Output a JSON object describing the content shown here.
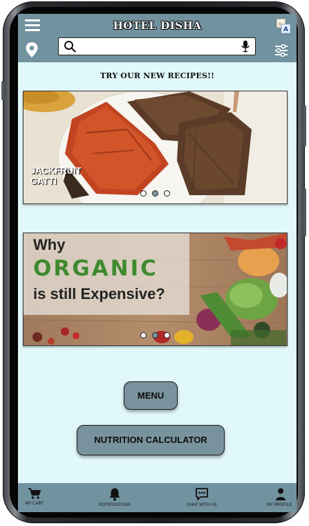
{
  "header": {
    "title": "HOTEL DISHA",
    "search": {
      "value": "",
      "placeholder": ""
    }
  },
  "recipes": {
    "heading": "TRY OUR NEW RECIPES!!",
    "slide_text": "JACKFRUIT\nGATTI",
    "slide_count": 3,
    "active_slide": 2
  },
  "organic": {
    "line1": "Why",
    "line2": "ORGANIC",
    "line3": "is still Expensive?",
    "slide_count": 3,
    "active_slide": 2
  },
  "buttons": {
    "menu": "MENU",
    "nutrition": "NUTRITION CALCULATOR"
  },
  "bottom_nav": [
    {
      "label": "MY CART",
      "icon": "cart-icon"
    },
    {
      "label": "NOTIFICATIONS",
      "icon": "bell-icon"
    },
    {
      "label": "CHAT WITH US",
      "icon": "chat-icon"
    },
    {
      "label": "MY PROFILE",
      "icon": "profile-icon"
    }
  ],
  "colors": {
    "header": "#71929f",
    "background": "#e1f8fb",
    "button": "#78939e"
  }
}
